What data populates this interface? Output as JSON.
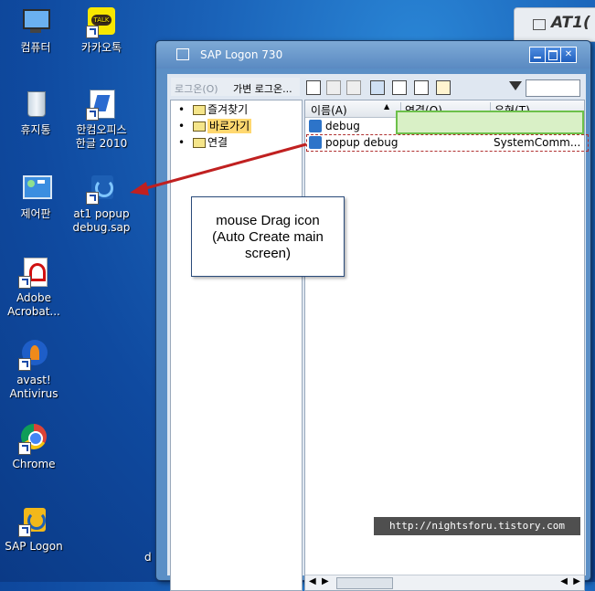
{
  "desktop": {
    "icons": [
      {
        "label": "컴퓨터",
        "icon": "computer-icon"
      },
      {
        "label": "카카오톡",
        "icon": "kakaotalk-icon"
      },
      {
        "label": "휴지통",
        "icon": "recycle-bin-icon"
      },
      {
        "label": "한컴오피스\n한글 2010",
        "icon": "hancom-icon"
      },
      {
        "label": "제어판",
        "icon": "control-panel-icon"
      },
      {
        "label": "at1 popup\ndebug.sap",
        "icon": "sap-shortcut-icon"
      },
      {
        "label": "Adobe\nAcrobat...",
        "icon": "adobe-icon"
      },
      {
        "label": "avast!\nAntivirus",
        "icon": "avast-icon"
      },
      {
        "label": "Chrome",
        "icon": "chrome-icon"
      },
      {
        "label": "SAP Logon",
        "icon": "sap-logon-icon"
      }
    ],
    "fragment": "d"
  },
  "background_window": {
    "title": "AT1("
  },
  "sap": {
    "title": "SAP Logon 730",
    "tabs": [
      "로그온(O)",
      "가변 로그온..."
    ],
    "tree": [
      "즐겨찾기",
      "바로가기",
      "연결"
    ],
    "columns": [
      "이름(A)",
      "연결(O)",
      "유형(T)"
    ],
    "rows": [
      {
        "name": "debug",
        "type": ""
      },
      {
        "name": "popup debug",
        "type": "SystemComm..."
      }
    ]
  },
  "callout": {
    "lines": [
      "mouse Drag icon",
      "(Auto Create main",
      "screen)"
    ]
  },
  "watermark": "http://nightsforu.tistory.com",
  "colors": {
    "accent": "#5a8ac2",
    "selection": "#ffd870",
    "drag_box": "#6cc04a",
    "arrow": "#c02020"
  }
}
